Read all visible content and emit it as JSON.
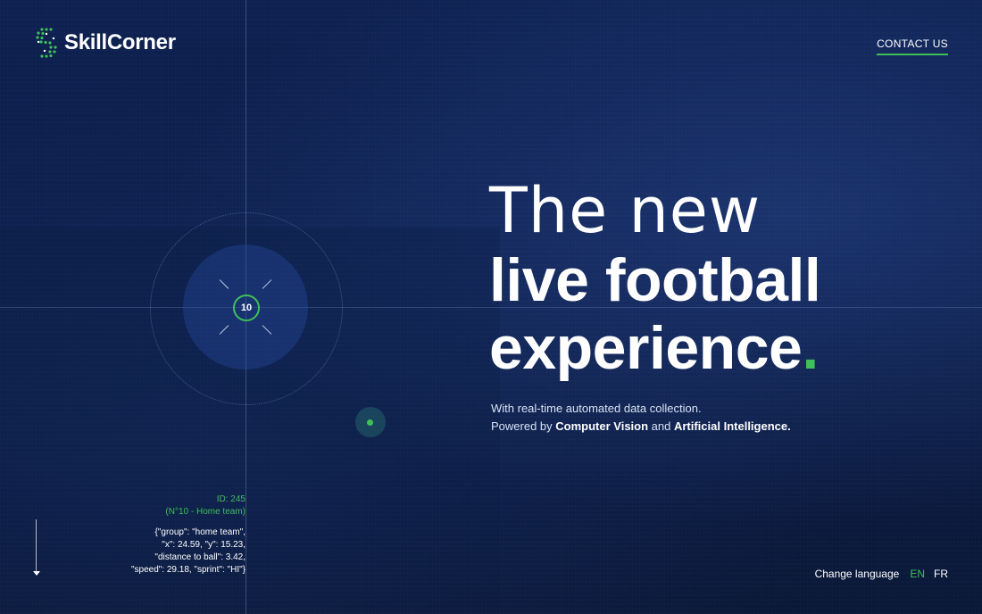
{
  "brand": {
    "name": "SkillCorner"
  },
  "nav": {
    "contact_label": "CONTACT US"
  },
  "hero": {
    "line1": "The new",
    "line2": "live football",
    "line3": "experience",
    "line3_dot": "."
  },
  "subtext": {
    "line1": "With real-time automated data collection.",
    "line2_prefix": "Powered by ",
    "line2_bold1": "Computer Vision",
    "line2_mid": " and ",
    "line2_bold2": "Artificial Intelligence."
  },
  "player": {
    "number": "10",
    "id_line": "ID: 245",
    "name_line": "(N°10 - Home team)",
    "json_lines": [
      "{\"group\": \"home team\",",
      "\"x\": 24.59, \"y\": 15.23,",
      "\"distance to ball\": 3.42,",
      "\"speed\": 29.18, \"sprint\": \"HI\"}"
    ]
  },
  "language": {
    "label": "Change language",
    "options": [
      "EN",
      "FR"
    ],
    "active": "EN"
  },
  "colors": {
    "accent": "#3fbf5a",
    "background": "#0b1a3d"
  },
  "icons": {
    "logo": "skillcorner-logo-icon",
    "scroll": "scroll-down-arrow-icon",
    "ball": "ball-marker-icon"
  }
}
